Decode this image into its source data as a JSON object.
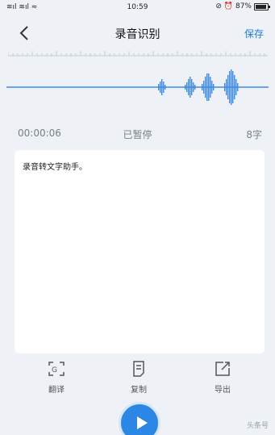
{
  "status_bar": {
    "signals": "≋ıl ≋ıl ≈",
    "time": "10:59",
    "icons": "⊘ ⏰",
    "battery_percent": "87%"
  },
  "nav": {
    "title": "录音识别",
    "save_label": "保存",
    "back_icon": "chevron-left-icon"
  },
  "info": {
    "elapsed": "00:00:06",
    "state": "已暂停",
    "char_count": "8字"
  },
  "transcript": {
    "text": "录音转文字助手。"
  },
  "actions": [
    {
      "label": "翻译",
      "icon": "translate-icon"
    },
    {
      "label": "复制",
      "icon": "copy-icon"
    },
    {
      "label": "导出",
      "icon": "export-icon"
    }
  ],
  "accent_color": "#2c86e6",
  "watermark": "头条号"
}
